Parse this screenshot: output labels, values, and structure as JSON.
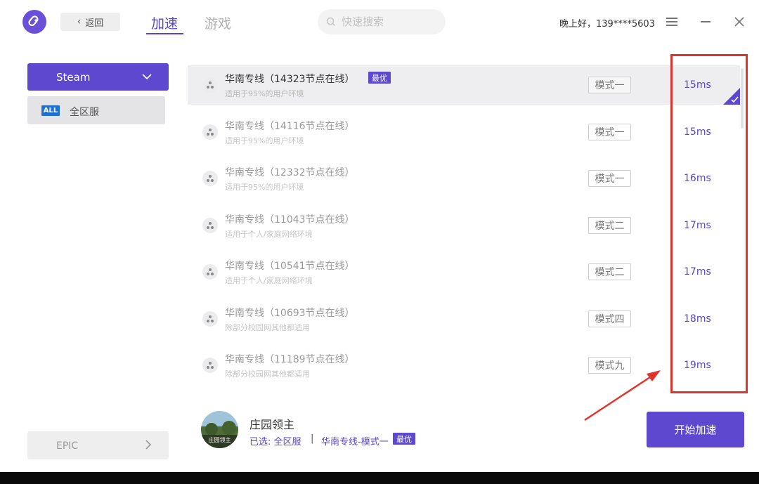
{
  "header": {
    "back_label": "返回",
    "tabs": [
      {
        "label": "加速",
        "active": true
      },
      {
        "label": "游戏",
        "active": false
      }
    ],
    "search_placeholder": "快速搜索",
    "greeting": "晚上好，139****5603",
    "accent_color": "#5a44c8"
  },
  "sidebar": {
    "platform": "Steam",
    "region_badge": "ALL",
    "region_label": "全区服",
    "other_platform": "EPIC"
  },
  "servers": [
    {
      "title": "华南专线（14323节点在线）",
      "desc": "适用于95%的用户环境",
      "mode": "模式一",
      "latency": "15ms",
      "best": "最优",
      "selected": true
    },
    {
      "title": "华南专线（14116节点在线）",
      "desc": "适用于95%的用户环境",
      "mode": "模式一",
      "latency": "15ms"
    },
    {
      "title": "华南专线（12332节点在线）",
      "desc": "适用于95%的用户环境",
      "mode": "模式一",
      "latency": "16ms"
    },
    {
      "title": "华南专线（11043节点在线）",
      "desc": "适用于个人/家庭网络环境",
      "mode": "模式二",
      "latency": "17ms"
    },
    {
      "title": "华南专线（10541节点在线）",
      "desc": "适用于个人/家庭网络环境",
      "mode": "模式二",
      "latency": "17ms"
    },
    {
      "title": "华南专线（10693节点在线）",
      "desc": "除部分校园网其他都适用",
      "mode": "模式四",
      "latency": "18ms"
    },
    {
      "title": "华南专线（11189节点在线）",
      "desc": "除部分校园网其他都适用",
      "mode": "模式九",
      "latency": "19ms"
    }
  ],
  "footer": {
    "game_name": "庄园领主",
    "cover_text": "庄园领主",
    "selected_prefix": "已选: 全区服",
    "separator": "|",
    "selected_line": "华南专线-模式一",
    "best": "最优",
    "start_label": "开始加速"
  },
  "annotation_color": "#e0342a"
}
